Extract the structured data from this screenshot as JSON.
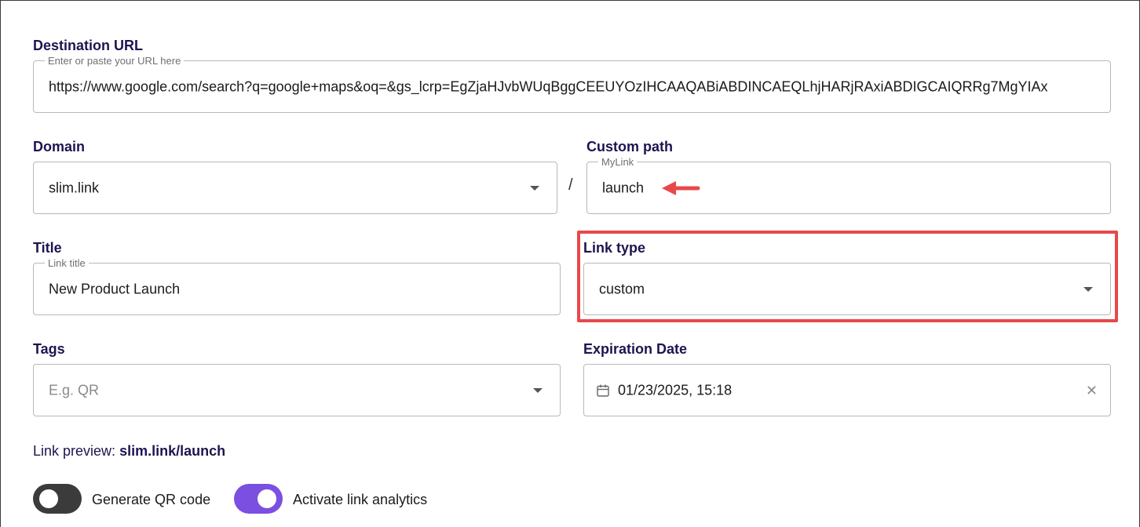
{
  "destination": {
    "label": "Destination URL",
    "legend": "Enter or paste your URL here",
    "value": "https://www.google.com/search?q=google+maps&oq=&gs_lcrp=EgZjaHJvbWUqBggCEEUYOzIHCAAQABiABDINCAEQLhjHARjRAxiABDIGCAIQRRg7MgYIAx"
  },
  "domain": {
    "label": "Domain",
    "value": "slim.link"
  },
  "separator": "/",
  "custom_path": {
    "label": "Custom path",
    "legend": "MyLink",
    "value": "launch"
  },
  "title": {
    "label": "Title",
    "legend": "Link title",
    "value": "New Product Launch"
  },
  "link_type": {
    "label": "Link type",
    "value": "custom"
  },
  "tags": {
    "label": "Tags",
    "placeholder": "E.g. QR"
  },
  "expiration": {
    "label": "Expiration Date",
    "value": "01/23/2025, 15:18"
  },
  "preview": {
    "prefix": "Link preview:",
    "link": "slim.link/launch"
  },
  "toggles": {
    "qr": {
      "label": "Generate QR code",
      "on": false
    },
    "analytics": {
      "label": "Activate link analytics",
      "on": true
    }
  },
  "colors": {
    "accent": "#7b4fe0",
    "toggle_off": "#3b3b3b",
    "label_text": "#1e1450",
    "annotation_red": "#e8484a"
  }
}
